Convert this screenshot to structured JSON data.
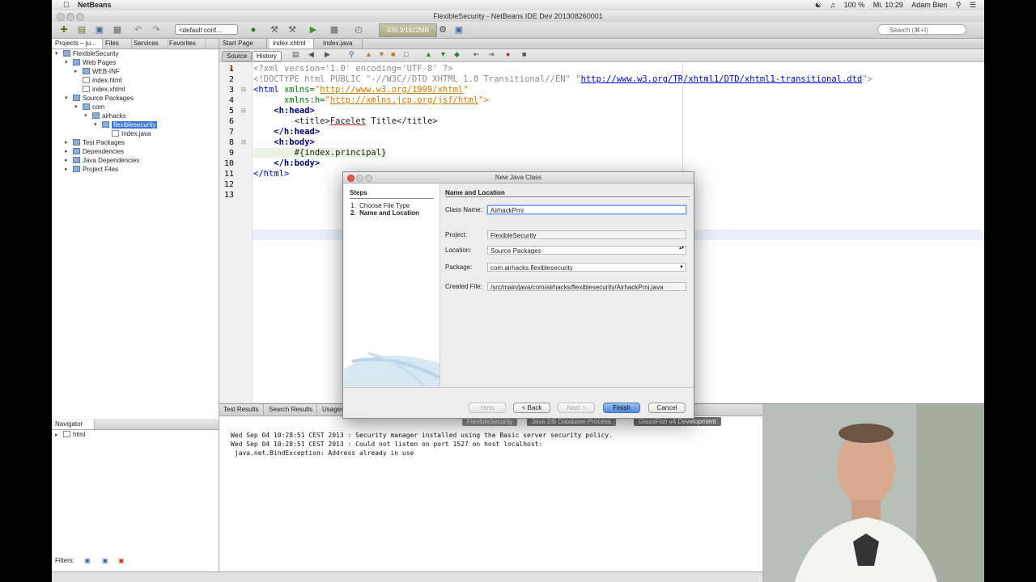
{
  "menubar": {
    "app": "NetBeans",
    "clock": "Mi. 10:29",
    "user": "Adam Bien",
    "battery": "100 %"
  },
  "window": {
    "title": "FlexibleSecurity - NetBeans IDE Dev 201308260001"
  },
  "toolbar": {
    "config": "<default conf...",
    "memory": "439,3/1922MB",
    "search_placeholder": "Search (⌘+I)"
  },
  "projects": {
    "tabs": [
      "Projects – ju...",
      "Files",
      "Services",
      "Favorites"
    ],
    "tree": [
      {
        "label": "FlexibleSecurity"
      },
      {
        "label": "Web Pages"
      },
      {
        "label": "WEB-INF"
      },
      {
        "label": "index.html"
      },
      {
        "label": "index.xhtml"
      },
      {
        "label": "Source Packages"
      },
      {
        "label": "com"
      },
      {
        "label": "airhacks"
      },
      {
        "label": "flexiblesecurity"
      },
      {
        "label": "Index.java"
      },
      {
        "label": "Test Packages"
      },
      {
        "label": "Dependencies"
      },
      {
        "label": "Java Dependencies"
      },
      {
        "label": "Project Files"
      }
    ]
  },
  "navigator": {
    "title": "Navigator",
    "item": "html",
    "filters_label": "Filters:"
  },
  "editor": {
    "tabs": [
      "Start Page",
      "index.xhtml",
      "Index.java"
    ],
    "source_btn": "Source",
    "history_btn": "History",
    "line_numbers": [
      "1",
      "2",
      "3",
      "4",
      "5",
      "6",
      "7",
      "8",
      "9",
      "10",
      "11",
      "12",
      "13"
    ],
    "code": {
      "l1": "<?xml version='1.0' encoding='UTF-8' ?>",
      "l2a": "<!DOCTYPE html PUBLIC \"-//W3C//DTD XHTML 1.0 Transitional//EN\" \"",
      "l2b": "http://www.w3.org/TR/xhtml1/DTD/xhtml1-transitional.dtd",
      "l2c": "\">",
      "l3a": "<html ",
      "l3b": "xmlns=",
      "l3c": "\"",
      "l3d": "http://www.w3.org/1999/xhtml",
      "l3e": "\"",
      "l4a": "      xmlns:h=",
      "l4b": "\"",
      "l4c": "http://xmlns.jcp.org/jsf/html",
      "l4d": "\">",
      "l5": "    <h:head>",
      "l6a": "        <title>",
      "l6b": "Facelet",
      "l6c": " Title</title>",
      "l7": "    </h:head>",
      "l8": "    <h:body>",
      "l9": "        #{index.principal}",
      "l10": "    </h:body>",
      "l11": "</html>"
    }
  },
  "output": {
    "tabs": [
      "Test Results",
      "Search Results",
      "Usages"
    ],
    "subtabs": [
      "FlexibleSecurity",
      "Java DB Database Process",
      "GlassFish v4 Development"
    ],
    "lines": [
      "Wed Sep 04 10:28:51 CEST 2013 : Security manager installed using the Basic server security policy.",
      "Wed Sep 04 10:28:51 CEST 2013 : Could not listen on port 1527 on host localhost:",
      " java.net.BindException: Address already in use"
    ]
  },
  "dialog": {
    "title": "New Java Class",
    "steps_heading": "Steps",
    "steps": [
      {
        "num": "1.",
        "label": "Choose File Type"
      },
      {
        "num": "2.",
        "label": "Name and Location"
      }
    ],
    "form_heading": "Name and Location",
    "fields": {
      "class_name_label": "Class Name:",
      "class_name_value": "AirhackPrni",
      "project_label": "Project:",
      "project_value": "FlexibleSecurity",
      "location_label": "Location:",
      "location_value": "Source Packages",
      "package_label": "Package:",
      "package_value": "com.airhacks.flexiblesecurity",
      "created_file_label": "Created File:",
      "created_file_value": "/src/main/java/com/airhacks/flexiblesecurity/AirhackPrni.java"
    },
    "buttons": {
      "help": "Help",
      "back": "< Back",
      "next": "Next >",
      "finish": "Finish",
      "cancel": "Cancel"
    }
  }
}
